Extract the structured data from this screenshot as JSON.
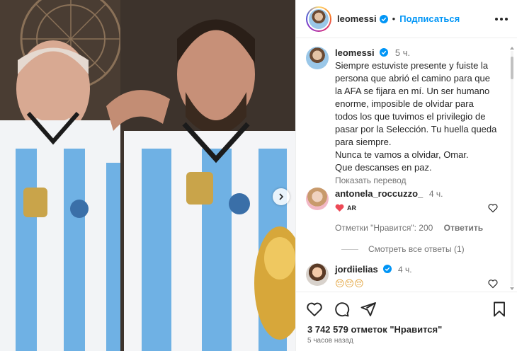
{
  "header": {
    "username": "leomessi",
    "separator": "•",
    "follow_label": "Подписаться"
  },
  "caption": {
    "username": "leomessi",
    "time": "5 ч.",
    "lines": [
      "Siempre estuviste presente y fuiste la",
      "persona que abrió el camino para que",
      "la AFA se fijara en mí. Un ser humano",
      "enorme, imposible de olvidar para",
      "todos los que tuvimos el privilegio de",
      "pasar por la Selección. Tu huella queda",
      "para siempre.",
      "Nunca te vamos a olvidar, Omar.",
      "Que descanses en paz."
    ],
    "translate_label": "Показать перевод"
  },
  "comments": [
    {
      "username": "antonela_roccuzzo_",
      "time": "4 ч.",
      "text": "AR",
      "likes_label": "Отметки \"Нравится\": 200",
      "reply_label": "Ответить"
    },
    {
      "username": "jordiielias",
      "time": "4 ч.",
      "text": "😔😔😔"
    }
  ],
  "replies_label": "Смотреть все ответы (1)",
  "likes_count": "3 742 579 отметок \"Нравится\"",
  "posted_ago": "5 часов назад",
  "colors": {
    "accent": "#0095f6",
    "verified": "#0095f6",
    "heart_red": "#ed4956",
    "muted": "#737373"
  },
  "icons": [
    "verified-icon",
    "more-icon",
    "heart-icon",
    "comment-icon",
    "share-icon",
    "bookmark-icon",
    "chevron-right-icon"
  ]
}
